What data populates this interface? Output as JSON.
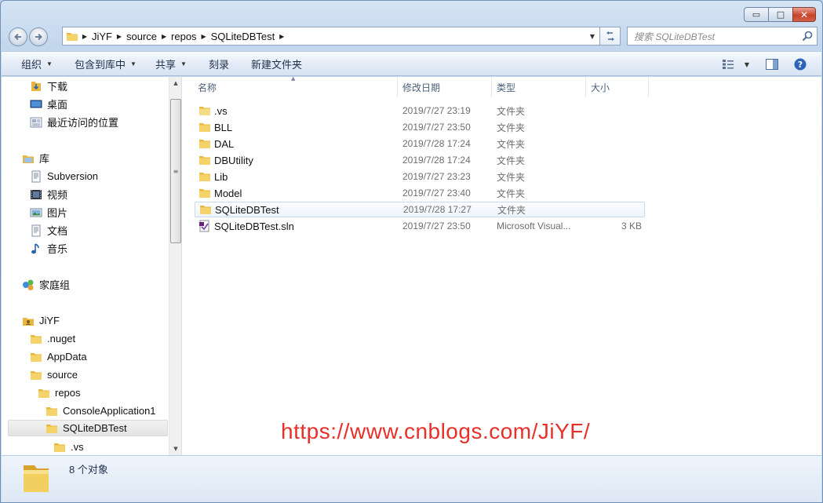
{
  "window": {
    "caption": {
      "minimize": "▭",
      "maximize": "□",
      "close": "✕"
    }
  },
  "address_bar": {
    "crumbs": [
      "JiYF",
      "source",
      "repos",
      "SQLiteDBTest"
    ],
    "search_placeholder": "搜索 SQLiteDBTest"
  },
  "toolbar": {
    "items": [
      "组织",
      "包含到库中",
      "共享",
      "刻录",
      "新建文件夹"
    ]
  },
  "nav_pane": {
    "items": [
      {
        "label": "下载",
        "icon": "download-folder-icon"
      },
      {
        "label": "桌面",
        "icon": "desktop-icon"
      },
      {
        "label": "最近访问的位置",
        "icon": "recent-places-icon"
      },
      {
        "label": "库",
        "icon": "libraries-icon"
      },
      {
        "label": "Subversion",
        "icon": "document-library-icon"
      },
      {
        "label": "视频",
        "icon": "video-library-icon"
      },
      {
        "label": "图片",
        "icon": "picture-library-icon"
      },
      {
        "label": "文档",
        "icon": "document-library-icon"
      },
      {
        "label": "音乐",
        "icon": "music-library-icon"
      },
      {
        "label": "家庭组",
        "icon": "homegroup-icon"
      },
      {
        "label": "JiYF",
        "icon": "user-folder-icon"
      },
      {
        "label": ".nuget",
        "icon": "folder-icon"
      },
      {
        "label": "AppData",
        "icon": "folder-icon"
      },
      {
        "label": "source",
        "icon": "folder-icon"
      },
      {
        "label": "repos",
        "icon": "folder-icon"
      },
      {
        "label": "ConsoleApplication1",
        "icon": "folder-icon"
      },
      {
        "label": "SQLiteDBTest",
        "icon": "folder-icon"
      },
      {
        "label": ".vs",
        "icon": "folder-icon"
      }
    ]
  },
  "file_list": {
    "columns": [
      "名称",
      "修改日期",
      "类型",
      "大小"
    ],
    "rows": [
      {
        "name": ".vs",
        "date": "2019/7/27 23:19",
        "type": "文件夹",
        "size": ""
      },
      {
        "name": "BLL",
        "date": "2019/7/27 23:50",
        "type": "文件夹",
        "size": ""
      },
      {
        "name": "DAL",
        "date": "2019/7/28 17:24",
        "type": "文件夹",
        "size": ""
      },
      {
        "name": "DBUtility",
        "date": "2019/7/28 17:24",
        "type": "文件夹",
        "size": ""
      },
      {
        "name": "Lib",
        "date": "2019/7/27 23:23",
        "type": "文件夹",
        "size": ""
      },
      {
        "name": "Model",
        "date": "2019/7/27 23:40",
        "type": "文件夹",
        "size": ""
      },
      {
        "name": "SQLiteDBTest",
        "date": "2019/7/28 17:27",
        "type": "文件夹",
        "size": ""
      },
      {
        "name": "SQLiteDBTest.sln",
        "date": "2019/7/27 23:50",
        "type": "Microsoft Visual...",
        "size": "3 KB"
      }
    ]
  },
  "watermark": "https://www.cnblogs.com/JiYF/",
  "status": {
    "item_count": "8 个对象"
  },
  "colors": {
    "folder": "#f2c94c",
    "selection_border": "#c7daf1",
    "watermark": "#e8302a"
  }
}
